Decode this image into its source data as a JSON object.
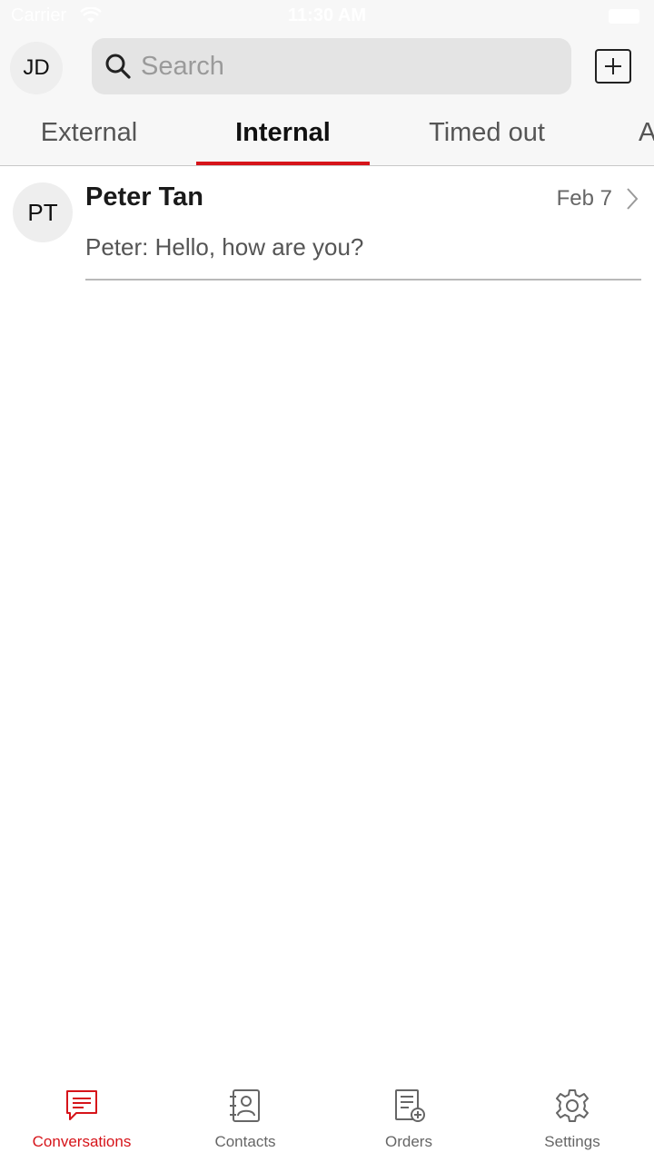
{
  "status_bar": {
    "carrier": "Carrier",
    "time": "11:30 AM"
  },
  "header": {
    "avatar_initials": "JD",
    "search_placeholder": "Search"
  },
  "tabs": [
    {
      "label": "External",
      "active": false
    },
    {
      "label": "Internal",
      "active": true
    },
    {
      "label": "Timed out",
      "active": false
    },
    {
      "label": "A",
      "active": false
    }
  ],
  "conversations": [
    {
      "initials": "PT",
      "name": "Peter Tan",
      "date": "Feb 7",
      "preview": "Peter: Hello, how are you?"
    }
  ],
  "tabbar": [
    {
      "label": "Conversations",
      "icon": "chat-icon",
      "active": true
    },
    {
      "label": "Contacts",
      "icon": "contacts-book-icon",
      "active": false
    },
    {
      "label": "Orders",
      "icon": "orders-document-icon",
      "active": false
    },
    {
      "label": "Settings",
      "icon": "gear-icon",
      "active": false
    }
  ],
  "colors": {
    "accent": "#d6141a",
    "header_bg": "#f7f7f7",
    "search_bg": "#e4e4e4"
  }
}
